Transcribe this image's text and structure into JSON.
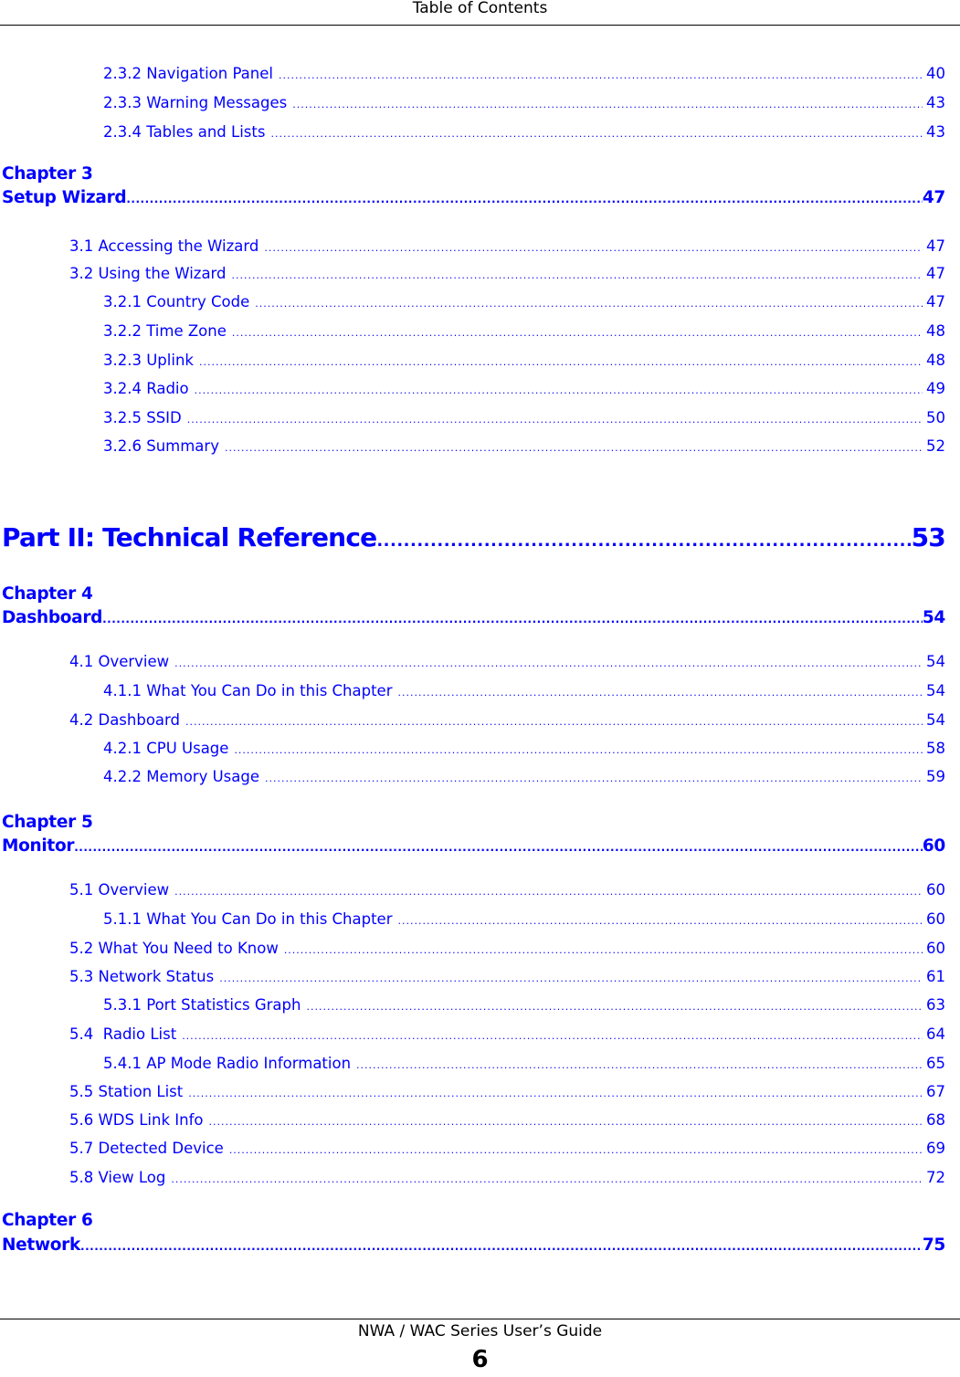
{
  "header": {
    "title": "Table of Contents"
  },
  "footer": {
    "title": "NWA / WAC Series User’s Guide",
    "page_number": "6"
  },
  "colors": {
    "link": "#0000ff",
    "text": "#000000"
  },
  "toc": {
    "pre_entries": [
      {
        "title": "2.3.2 Navigation Panel",
        "page": "40"
      },
      {
        "title": "2.3.3 Warning Messages",
        "page": "43"
      },
      {
        "title": "2.3.4 Tables and Lists",
        "page": "43"
      }
    ],
    "chapter3": {
      "label": "Chapter 3",
      "title": "Setup Wizard",
      "page": "47",
      "entries": [
        {
          "title": "3.1 Accessing the Wizard",
          "page": "47"
        },
        {
          "title": "3.2 Using the Wizard",
          "page": "47"
        },
        {
          "title": "3.2.1 Country Code",
          "page": "47"
        },
        {
          "title": "3.2.2 Time Zone",
          "page": "48"
        },
        {
          "title": "3.2.3 Uplink",
          "page": "48"
        },
        {
          "title": "3.2.4 Radio",
          "page": "49"
        },
        {
          "title": "3.2.5 SSID",
          "page": "50"
        },
        {
          "title": "3.2.6 Summary",
          "page": "52"
        }
      ]
    },
    "part2": {
      "title": "Part II: Technical Reference",
      "page": "53"
    },
    "chapter4": {
      "label": "Chapter 4",
      "title": "Dashboard",
      "page": "54",
      "entries": [
        {
          "title": "4.1 Overview",
          "page": "54"
        },
        {
          "title": "4.1.1 What You Can Do in this Chapter",
          "page": "54"
        },
        {
          "title": "4.2 Dashboard",
          "page": "54"
        },
        {
          "title": "4.2.1 CPU Usage",
          "page": "58"
        },
        {
          "title": "4.2.2 Memory Usage",
          "page": "59"
        }
      ]
    },
    "chapter5": {
      "label": "Chapter 5",
      "title": "Monitor",
      "page": "60",
      "entries": [
        {
          "title": "5.1 Overview",
          "page": "60"
        },
        {
          "title": "5.1.1 What You Can Do in this Chapter",
          "page": "60"
        },
        {
          "title": "5.2 What You Need to Know",
          "page": "60"
        },
        {
          "title": "5.3 Network Status",
          "page": "61"
        },
        {
          "title": "5.3.1 Port Statistics Graph",
          "page": "63"
        },
        {
          "title": "5.4  Radio List",
          "page": "64"
        },
        {
          "title": "5.4.1 AP Mode Radio Information",
          "page": "65"
        },
        {
          "title": "5.5 Station List",
          "page": "67"
        },
        {
          "title": "5.6 WDS Link Info",
          "page": "68"
        },
        {
          "title": "5.7 Detected Device",
          "page": "69"
        },
        {
          "title": "5.8 View Log",
          "page": "72"
        }
      ]
    },
    "chapter6": {
      "label": "Chapter 6",
      "title": "Network",
      "page": "75"
    }
  }
}
